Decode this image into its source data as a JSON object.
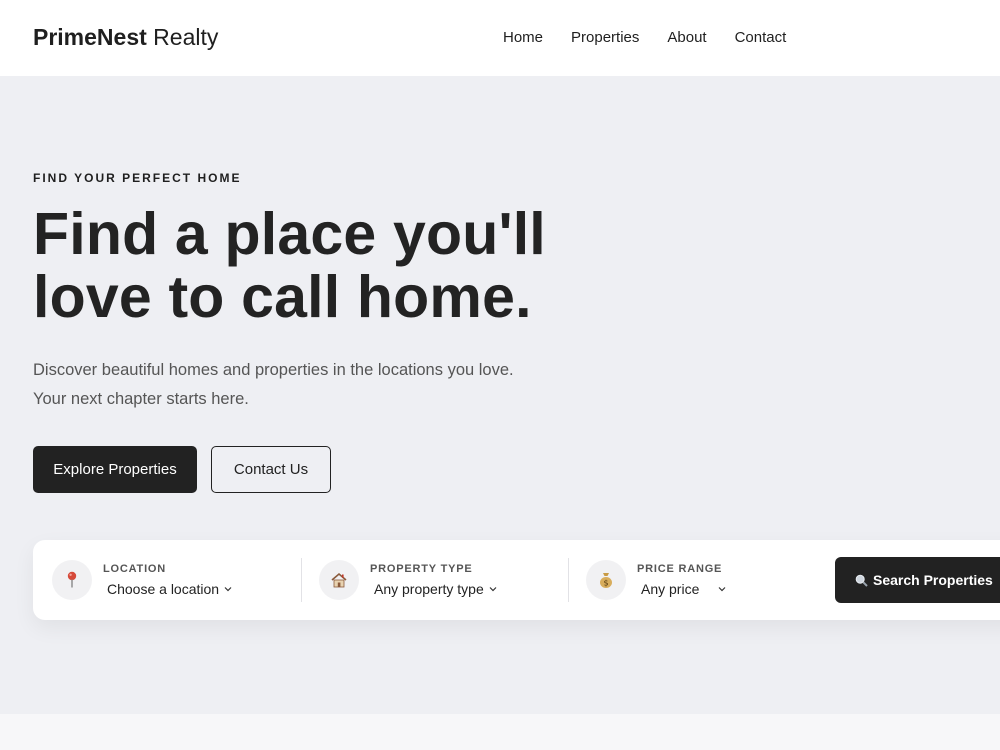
{
  "header": {
    "brand_bold": "PrimeNest",
    "brand_rest": "Realty",
    "nav": [
      "Home",
      "Properties",
      "About",
      "Contact"
    ]
  },
  "hero": {
    "eyebrow": "FIND YOUR PERFECT HOME",
    "headline_line1": "Find a place you'll",
    "headline_line2": "love to call home.",
    "subtext_line1": "Discover beautiful homes and properties in the locations you love.",
    "subtext_line2": "Your next chapter starts here.",
    "primary_button": "Explore Properties",
    "secondary_button": "Contact Us"
  },
  "search": {
    "fields": [
      {
        "label": "LOCATION",
        "value": "Choose a location",
        "icon": "map-pin-icon"
      },
      {
        "label": "PROPERTY TYPE",
        "value": "Any property type",
        "icon": "house-icon"
      },
      {
        "label": "PRICE RANGE",
        "value": "Any price",
        "icon": "money-bag-icon"
      }
    ],
    "button_label": "Search Properties",
    "button_icon": "search-icon"
  },
  "colors": {
    "hero_bg": "#eeeff3",
    "dark": "#222222",
    "card_bg": "#ffffff",
    "pin_red": "#d64a3a"
  }
}
